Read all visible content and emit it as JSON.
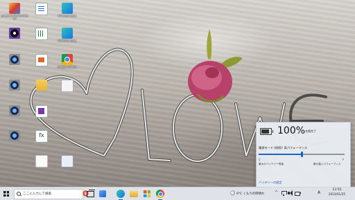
{
  "desktop": {
    "icons": [
      {
        "label": "Cyberlink Media Suite 10",
        "icon": "media-suite-icon"
      },
      {
        "label": "",
        "icon": "document-icon"
      },
      {
        "label": "",
        "icon": "media-player-icon"
      },
      {
        "label": "",
        "icon": "spreadsheet-icon"
      },
      {
        "label": "Microsoft Edge",
        "icon": "edge-icon"
      },
      {
        "label": "",
        "icon": "app-icon"
      },
      {
        "label": "",
        "icon": "presentation-icon"
      },
      {
        "label": "Google Chrome",
        "icon": "chrome-icon"
      },
      {
        "label": "",
        "icon": "app-icon"
      },
      {
        "label": "",
        "icon": "folder-icon"
      },
      {
        "label": "",
        "icon": "document-icon"
      },
      {
        "label": "",
        "icon": "app-icon"
      },
      {
        "label": "",
        "icon": "presentation-icon"
      },
      {
        "label": "",
        "icon": "app-icon"
      },
      {
        "label": "",
        "icon": "fx-document-icon"
      },
      {
        "label": "",
        "icon": "blank-document-icon"
      },
      {
        "label": "",
        "icon": "doc-icon"
      }
    ]
  },
  "battery_flyout": {
    "percent": "100%",
    "status": "充電完了",
    "power_mode_label": "電源モード (接続): 高パフォーマンス",
    "slider_value": 0.5,
    "slider_left_label": "最大のバッテリー残量",
    "slider_right_label": "最も高いパフォーマンス",
    "settings_link": "バッテリーの設定",
    "accent": "#1a63c7"
  },
  "taskbar": {
    "search_placeholder": "ここに入力して検索",
    "pinned": [
      "task-view-icon",
      "widgets-icon",
      "edge-icon",
      "file-explorer-icon",
      "store-icon",
      "chrome-icon"
    ],
    "tray": {
      "weather": "9°C くもりの時晴れ",
      "chevron": "^",
      "ime": "A",
      "time": "13:55",
      "date": "2023/01/25"
    }
  }
}
